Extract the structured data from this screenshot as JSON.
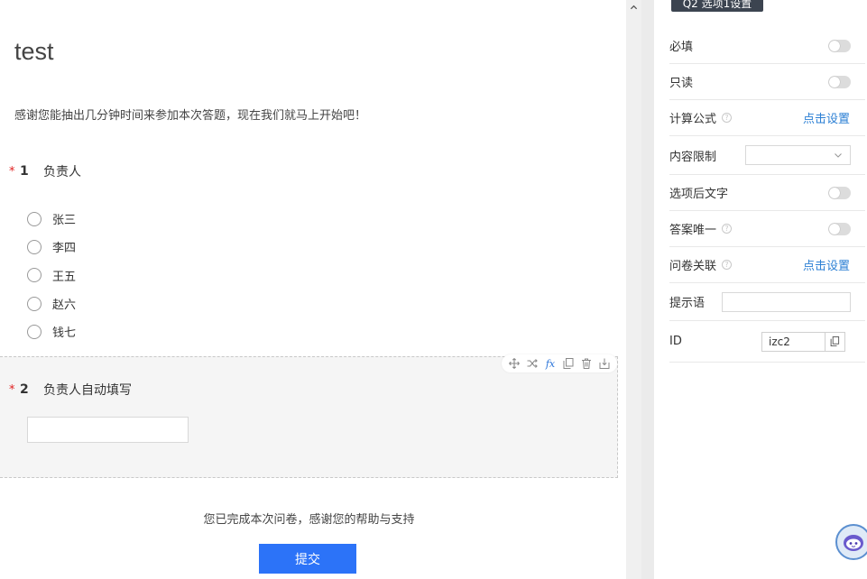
{
  "survey": {
    "title": "test",
    "intro": "感谢您能抽出几分钟时间来参加本次答题，现在我们就马上开始吧！",
    "questions": [
      {
        "required_mark": "*",
        "number": "1",
        "title": "负责人",
        "options": [
          "张三",
          "李四",
          "王五",
          "赵六",
          "钱七"
        ]
      },
      {
        "required_mark": "*",
        "number": "2",
        "title": "负责人自动填写",
        "input_value": ""
      }
    ],
    "toolbar": {
      "fx_label": "fx"
    },
    "finish_text": "您已完成本次问卷，感谢您的帮助与支持",
    "submit_label": "提交"
  },
  "panel": {
    "header_tag": "Q2 选项1设置",
    "rows": {
      "required": {
        "label": "必填",
        "toggle_on": false
      },
      "readonly": {
        "label": "只读",
        "toggle_on": false
      },
      "formula": {
        "label": "计算公式",
        "help": "?",
        "link": "点击设置"
      },
      "content_limit": {
        "label": "内容限制",
        "value": ""
      },
      "text_after_option": {
        "label": "选项后文字",
        "toggle_on": false
      },
      "unique_answer": {
        "label": "答案唯一",
        "help": "?",
        "toggle_on": false
      },
      "survey_link": {
        "label": "问卷关联",
        "help": "?",
        "link": "点击设置"
      },
      "hint": {
        "label": "提示语",
        "value": ""
      },
      "id": {
        "label": "ID",
        "value": "izc2"
      }
    }
  },
  "colors": {
    "primary": "#2c73f8",
    "link": "#2b7fd4",
    "required": "#e02020",
    "tag_bg": "#3c4450"
  }
}
